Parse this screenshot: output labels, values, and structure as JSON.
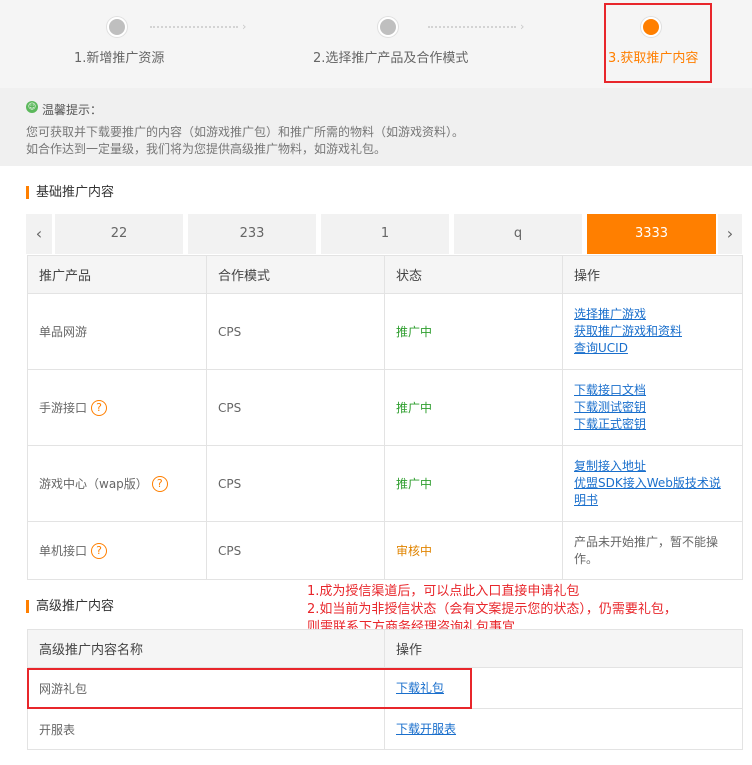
{
  "steps": [
    {
      "label": "1.新增推广资源",
      "active": false
    },
    {
      "label": "2.选择推广产品及合作模式",
      "active": false
    },
    {
      "label": "3.获取推广内容",
      "active": true
    }
  ],
  "tips": {
    "title": "温馨提示：",
    "lines": [
      "您可获取并下载要推广的内容（如游戏推广包）和推广所需的物料（如游戏资料）。",
      "如合作达到一定量级，我们将为您提供高级推广物料，如游戏礼包。"
    ]
  },
  "basic": {
    "title": "基础推广内容",
    "tabs": [
      "22",
      "233",
      "1",
      "q",
      "3333"
    ],
    "active_tab": "3333",
    "headers": [
      "推广产品",
      "合作模式",
      "状态",
      "操作"
    ],
    "rows": [
      {
        "product": "单品网游",
        "help": false,
        "mode": "CPS",
        "status": "推广中",
        "ops": [
          "选择推广游戏",
          "获取推广游戏和资料",
          "查询UCID"
        ]
      },
      {
        "product": "手游接口",
        "help": true,
        "mode": "CPS",
        "status": "推广中",
        "ops": [
          "下载接口文档",
          "下载测试密钥",
          "下载正式密钥"
        ]
      },
      {
        "product": "游戏中心（wap版）",
        "help": true,
        "mode": "CPS",
        "status": "推广中",
        "ops": [
          "复制接入地址",
          "优盟SDK接入Web版技术说",
          "明书"
        ]
      },
      {
        "product": "单机接口",
        "help": true,
        "mode": "CPS",
        "status": "审核中",
        "note": [
          "产品未开始推广，暂不能操",
          "作。"
        ]
      }
    ]
  },
  "annotation": [
    "1.成为授信渠道后，可以点此入口直接申请礼包",
    "2.如当前为非授信状态（会有文案提示您的状态），仍需要礼包，",
    "则需联系下方商务经理咨询礼包事宜"
  ],
  "advanced": {
    "title": "高级推广内容",
    "headers": [
      "高级推广内容名称",
      "操作"
    ],
    "rows": [
      {
        "name": "网游礼包",
        "op": "下载礼包"
      },
      {
        "name": "开服表",
        "op": "下载开服表"
      }
    ]
  },
  "icons": {
    "help": "question-circle-icon",
    "tip": "smile-icon",
    "prev": "chevron-left-icon",
    "next": "chevron-right-icon"
  },
  "colors": {
    "accent": "#ff7f00",
    "link": "#1a6fcc",
    "status_on": "#2e9e2e",
    "status_review": "#e08400",
    "annotation": "#e8262b"
  }
}
